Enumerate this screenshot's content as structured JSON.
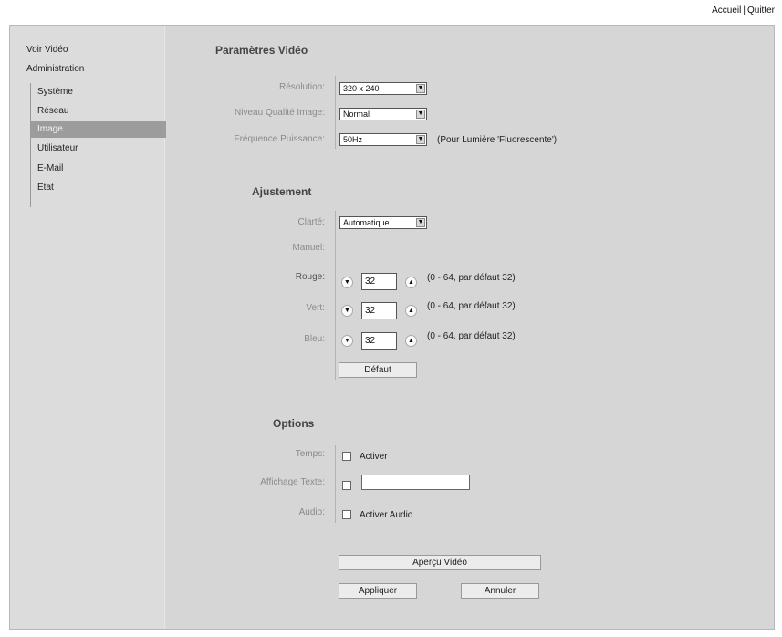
{
  "header": {
    "home_link": "Accueil",
    "separator": "|",
    "quit_link": "Quitter"
  },
  "sidebar": {
    "top_items": [
      {
        "label": "Voir Vidéo"
      },
      {
        "label": "Administration"
      }
    ],
    "sub_items": [
      {
        "label": "Système",
        "active": false
      },
      {
        "label": "Réseau",
        "active": false
      },
      {
        "label": "Image",
        "active": true
      },
      {
        "label": "Utilisateur",
        "active": false
      },
      {
        "label": "E-Mail",
        "active": false
      },
      {
        "label": "Etat",
        "active": false
      }
    ]
  },
  "video_params": {
    "title": "Paramètres Vidéo",
    "resolution": {
      "label": "Résolution:",
      "value": "320 x 240"
    },
    "quality": {
      "label": "Niveau Qualité Image:",
      "value": "Normal"
    },
    "frequency": {
      "label": "Fréquence Puissance:",
      "value": "50Hz",
      "note": "(Pour Lumière 'Fluorescente')"
    }
  },
  "adjustment": {
    "title": "Ajustement",
    "clarity": {
      "label": "Clarté:",
      "value": "Automatique"
    },
    "manual_label": "Manuel:",
    "channels": [
      {
        "label": "Rouge:",
        "value": "32",
        "hint": "(0 - 64, par défaut 32)"
      },
      {
        "label": "Vert:",
        "value": "32",
        "hint": "(0 - 64, par défaut 32)"
      },
      {
        "label": "Bleu:",
        "value": "32",
        "hint": "(0 - 64, par défaut 32)"
      }
    ],
    "default_button": "Défaut"
  },
  "options": {
    "title": "Options",
    "time": {
      "label": "Temps:",
      "checkbox_label": "Activer",
      "checked": false
    },
    "text_display": {
      "label": "Affichage Texte:",
      "checked": false,
      "value": ""
    },
    "audio": {
      "label": "Audio:",
      "checkbox_label": "Activer Audio",
      "checked": false
    }
  },
  "actions": {
    "preview": "Aperçu Vidéo",
    "apply": "Appliquer",
    "cancel": "Annuler"
  },
  "icons": {
    "dropdown": "chevron-down-icon",
    "decrement": "arrow-down-icon",
    "increment": "arrow-up-icon"
  }
}
